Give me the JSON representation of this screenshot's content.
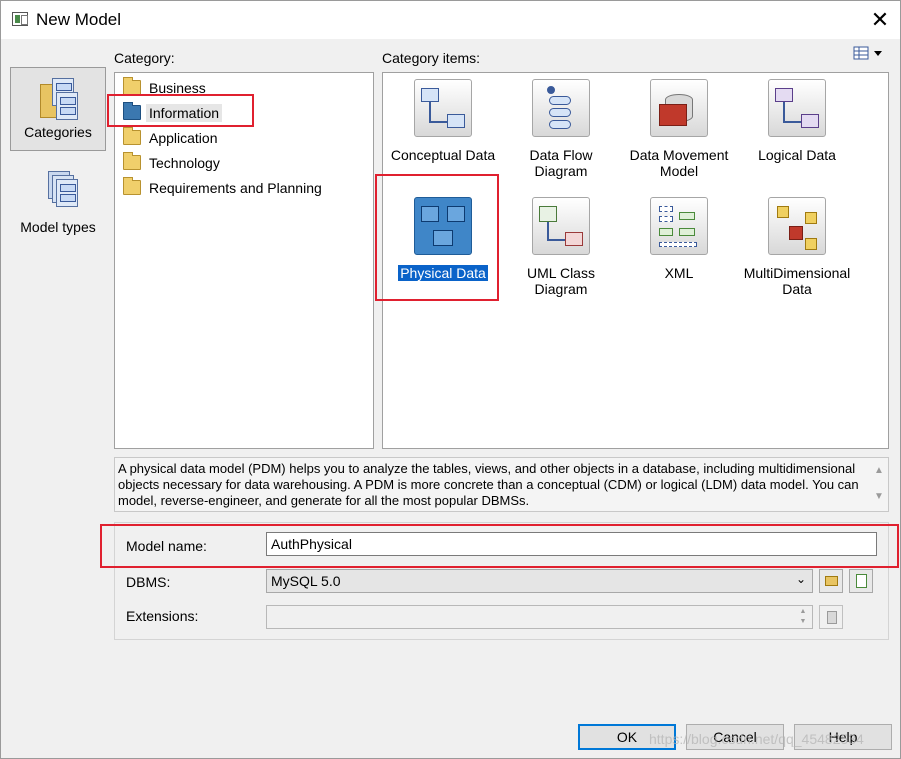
{
  "window": {
    "title": "New Model",
    "close_label": "✕"
  },
  "nav": [
    {
      "id": "categories",
      "label": "Categories",
      "icon": "categories-icon",
      "active": true
    },
    {
      "id": "model-types",
      "label": "Model types",
      "icon": "model-types-icon",
      "active": false
    }
  ],
  "category": {
    "heading": "Category:",
    "items": [
      {
        "label": "Business",
        "icon": "folder-icon"
      },
      {
        "label": "Information",
        "icon": "information-folder-icon",
        "selected": true
      },
      {
        "label": "Application",
        "icon": "folder-icon"
      },
      {
        "label": "Technology",
        "icon": "folder-icon"
      },
      {
        "label": "Requirements and Planning",
        "icon": "folder-icon"
      }
    ]
  },
  "category_items": {
    "heading": "Category items:",
    "view_menu_icon": "view-options-icon",
    "items": [
      {
        "label": "Conceptual Data",
        "icon": "conceptual-data-icon"
      },
      {
        "label": "Data Flow Diagram",
        "icon": "data-flow-diagram-icon"
      },
      {
        "label": "Data Movement Model",
        "icon": "data-movement-model-icon"
      },
      {
        "label": "Logical Data",
        "icon": "logical-data-icon"
      },
      {
        "label": "Physical Data",
        "icon": "physical-data-icon",
        "selected": true
      },
      {
        "label": "UML Class Diagram",
        "icon": "uml-class-diagram-icon"
      },
      {
        "label": "XML",
        "icon": "xml-icon"
      },
      {
        "label": "MultiDimensional Data",
        "icon": "multidimensional-data-icon"
      }
    ]
  },
  "description": "A physical data model (PDM) helps you to analyze the tables, views, and other objects in a database, including multidimensional objects necessary for data warehousing. A PDM is more concrete than a conceptual (CDM) or logical (LDM) data model. You can model, reverse-engineer, and generate for all the most popular DBMSs.",
  "form": {
    "model_name_label": "Model name:",
    "model_name_value": "AuthPhysical",
    "dbms_label": "DBMS:",
    "dbms_value": "MySQL 5.0",
    "extensions_label": "Extensions:",
    "extensions_value": ""
  },
  "buttons": {
    "ok": "OK",
    "cancel": "Cancel",
    "help": "Help"
  },
  "watermark": "https://blog.csdn.net/qq_45482534",
  "colors": {
    "selection": "#0a63c9",
    "highlight_box": "#e0202f",
    "ok_border": "#0078d7"
  }
}
